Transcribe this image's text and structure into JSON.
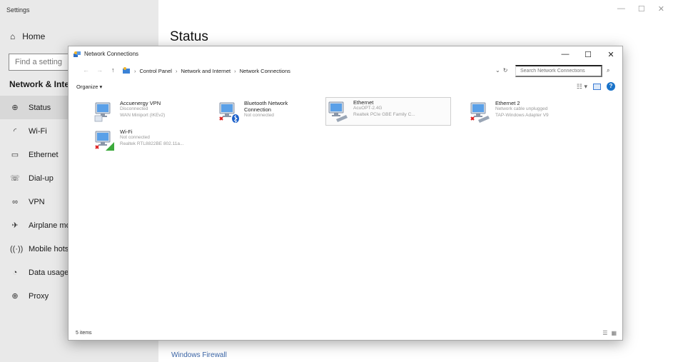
{
  "settings": {
    "title": "Settings",
    "home_label": "Home",
    "search_placeholder": "Find a setting",
    "section_heading": "Network & Interne",
    "nav_items": [
      {
        "label": "Status",
        "icon": "globe-icon",
        "glyph": "⊕"
      },
      {
        "label": "Wi-Fi",
        "icon": "wifi-icon",
        "glyph": "◜"
      },
      {
        "label": "Ethernet",
        "icon": "ethernet-icon",
        "glyph": "▭"
      },
      {
        "label": "Dial-up",
        "icon": "dialup-icon",
        "glyph": "☏"
      },
      {
        "label": "VPN",
        "icon": "vpn-icon",
        "glyph": "∞"
      },
      {
        "label": "Airplane moc",
        "icon": "airplane-icon",
        "glyph": "✈"
      },
      {
        "label": "Mobile hotsp",
        "icon": "hotspot-icon",
        "glyph": "((·))"
      },
      {
        "label": "Data usage",
        "icon": "data-usage-icon",
        "glyph": "◔"
      },
      {
        "label": "Proxy",
        "icon": "proxy-icon",
        "glyph": "⊕"
      }
    ],
    "page_title": "Status",
    "firewall_link": "Windows Firewall"
  },
  "nc": {
    "title": "Network Connections",
    "minimize": "—",
    "maximize": "☐",
    "close": "✕",
    "breadcrumb": [
      "Control Panel",
      "Network and Internet",
      "Network Connections"
    ],
    "search_placeholder": "Search Network Connections",
    "organize": "Organize ▾",
    "connections": [
      {
        "name": "Accuenergy VPN",
        "status": "Disconnected",
        "device": "WAN Miniport (IKEv2)",
        "type": "vpn"
      },
      {
        "name": "Bluetooth Network Connection",
        "status": "Not connected",
        "device": "",
        "type": "bluetooth"
      },
      {
        "name": "Ethernet",
        "status": "AcuOPT-2.4G",
        "device": "Realtek PCIe GBE Family C...",
        "type": "ethernet"
      },
      {
        "name": "Ethernet 2",
        "status": "Network cable unplugged",
        "device": "TAP-Windows Adapter V9",
        "type": "ethernet-x"
      },
      {
        "name": "Wi-Fi",
        "status": "Not connected",
        "device": "Realtek RTL8822BE 802.11a...",
        "type": "wifi-x"
      }
    ],
    "items_count": "5 items"
  },
  "colors": {
    "accent": "#1a73c9",
    "error": "#e02020",
    "sidebar": "#e9e9e9",
    "link": "#3b66a8"
  }
}
